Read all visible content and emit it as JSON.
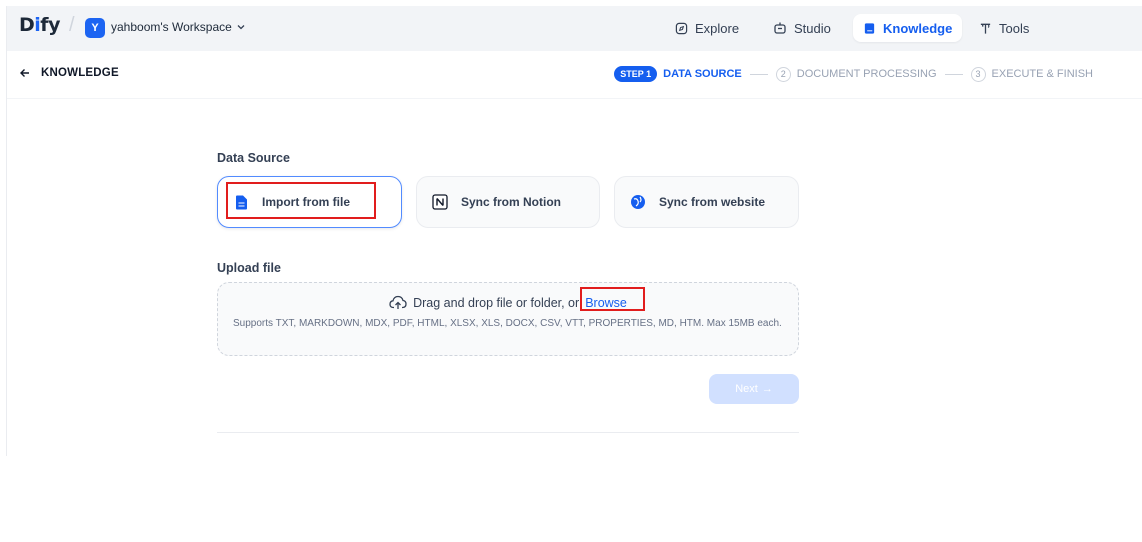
{
  "header": {
    "logo_prefix": "D",
    "logo_i": "i",
    "logo_suffix": "fy",
    "workspace_initial": "Y",
    "workspace_name": "yahboom's Workspace",
    "nav": [
      {
        "label": "Explore",
        "icon": "compass-icon",
        "active": false
      },
      {
        "label": "Studio",
        "icon": "robot-icon",
        "active": false
      },
      {
        "label": "Knowledge",
        "icon": "book-icon",
        "active": true
      },
      {
        "label": "Tools",
        "icon": "hammer-icon",
        "active": false
      }
    ]
  },
  "subheader": {
    "back_label": "KNOWLEDGE",
    "steps": {
      "step1_badge": "STEP 1",
      "step1_label": "DATA SOURCE",
      "step2_num": "2",
      "step2_label": "DOCUMENT PROCESSING",
      "step3_num": "3",
      "step3_label": "EXECUTE & FINISH"
    }
  },
  "main": {
    "data_source_title": "Data Source",
    "sources": [
      {
        "label": "Import from file",
        "icon": "file-icon",
        "selected": true
      },
      {
        "label": "Sync from Notion",
        "icon": "notion-icon",
        "selected": false
      },
      {
        "label": "Sync from website",
        "icon": "globe-icon",
        "selected": false
      }
    ],
    "upload_title": "Upload file",
    "upload": {
      "prompt": "Drag and drop file or folder, or",
      "browse": "Browse",
      "hint": "Supports TXT, MARKDOWN, MDX, PDF, HTML, XLSX, XLS, DOCX, CSV, VTT, PROPERTIES, MD, HTM. Max 15MB each."
    },
    "next_label": "Next",
    "next_arrow": "→"
  },
  "colors": {
    "accent": "#155eef",
    "highlight": "#e11d1d",
    "next_disabled": "#d1e0ff"
  }
}
